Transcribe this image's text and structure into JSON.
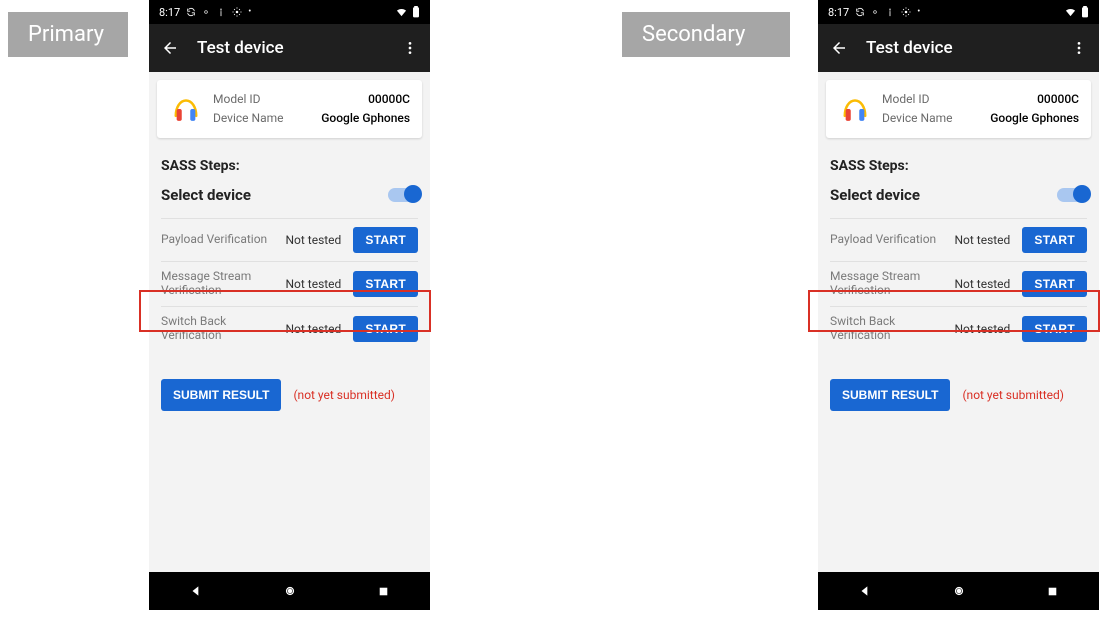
{
  "labels": {
    "primary": "Primary",
    "secondary": "Secondary"
  },
  "status": {
    "time": "8:17"
  },
  "appbar": {
    "title": "Test device"
  },
  "card": {
    "model_label": "Model ID",
    "model_value": "00000C",
    "name_label": "Device Name",
    "name_value": "Google Gphones"
  },
  "section": {
    "sass_title": "SASS Steps:",
    "select_label": "Select device"
  },
  "tests": [
    {
      "name": "Payload Verification",
      "status": "Not tested",
      "button": "START"
    },
    {
      "name": "Message Stream Verification",
      "status": "Not tested",
      "button": "START"
    },
    {
      "name": "Switch Back Verification",
      "status": "Not tested",
      "button": "START"
    }
  ],
  "submit": {
    "button": "SUBMIT RESULT",
    "note": "(not yet submitted)"
  }
}
